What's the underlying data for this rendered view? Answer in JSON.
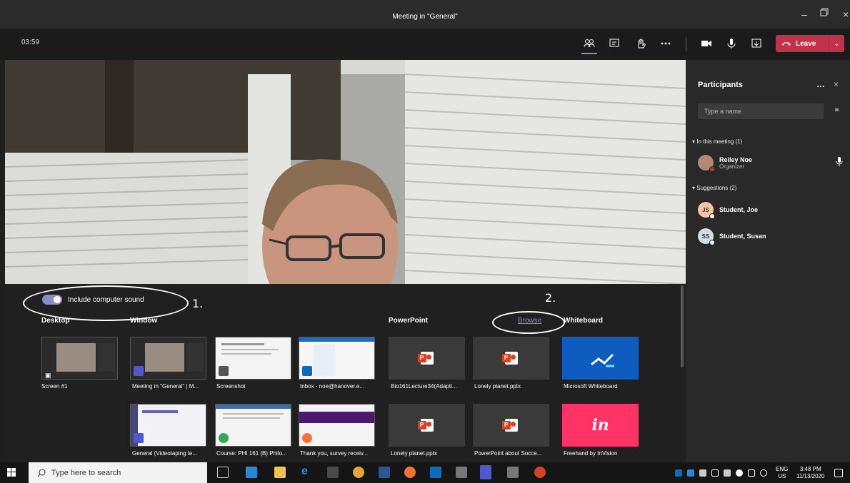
{
  "window": {
    "title": "Meeting in \"General\""
  },
  "meeting": {
    "timer": "03:59",
    "leave_label": "Leave"
  },
  "share": {
    "include_sound_label": "Include computer sound",
    "annotation_1": "1.",
    "annotation_2": "2.",
    "sections": {
      "desktop": "Desktop",
      "window": "Window",
      "powerpoint": "PowerPoint",
      "browse": "Browse",
      "whiteboard": "Whiteboard"
    },
    "desktop_items": [
      {
        "label": "Screen #1"
      }
    ],
    "window_items": [
      {
        "label": "Meeting in \"General\" | M..."
      },
      {
        "label": "Screenshot"
      },
      {
        "label": "Inbox - noe@hanover.e..."
      },
      {
        "label": "General (Videotaping te..."
      },
      {
        "label": "Course: PHI 161 (B) Philo..."
      },
      {
        "label": "Thank you, survey receiv..."
      }
    ],
    "powerpoint_items": [
      {
        "label": "Bio161Lecture34(Adapti..."
      },
      {
        "label": "Lonely planet.pptx"
      },
      {
        "label": "Lonely planet.pptx"
      },
      {
        "label": "PowerPoint about Socce..."
      }
    ],
    "whiteboard_items": [
      {
        "label": "Microsoft Whiteboard"
      },
      {
        "label": "Freehand by InVision",
        "glyph": "in"
      }
    ]
  },
  "participants": {
    "title": "Participants",
    "search_placeholder": "Type a name",
    "in_meeting_header": "In this meeting (1)",
    "suggestions_header": "Suggestions (2)",
    "in_meeting": [
      {
        "name": "Reiley Noe",
        "role": "Organizer"
      }
    ],
    "suggestions": [
      {
        "initials": "JS",
        "name": "Student, Joe"
      },
      {
        "initials": "SS",
        "name": "Student, Susan"
      }
    ]
  },
  "taskbar": {
    "search_placeholder": "Type here to search",
    "lang": "ENG",
    "region": "US",
    "time": "3:48 PM",
    "date": "11/13/2020"
  },
  "colors": {
    "accent": "#8b8cc7",
    "leave": "#c4314b",
    "whiteboard": "#0f5cc0",
    "invision": "#ff3366"
  }
}
